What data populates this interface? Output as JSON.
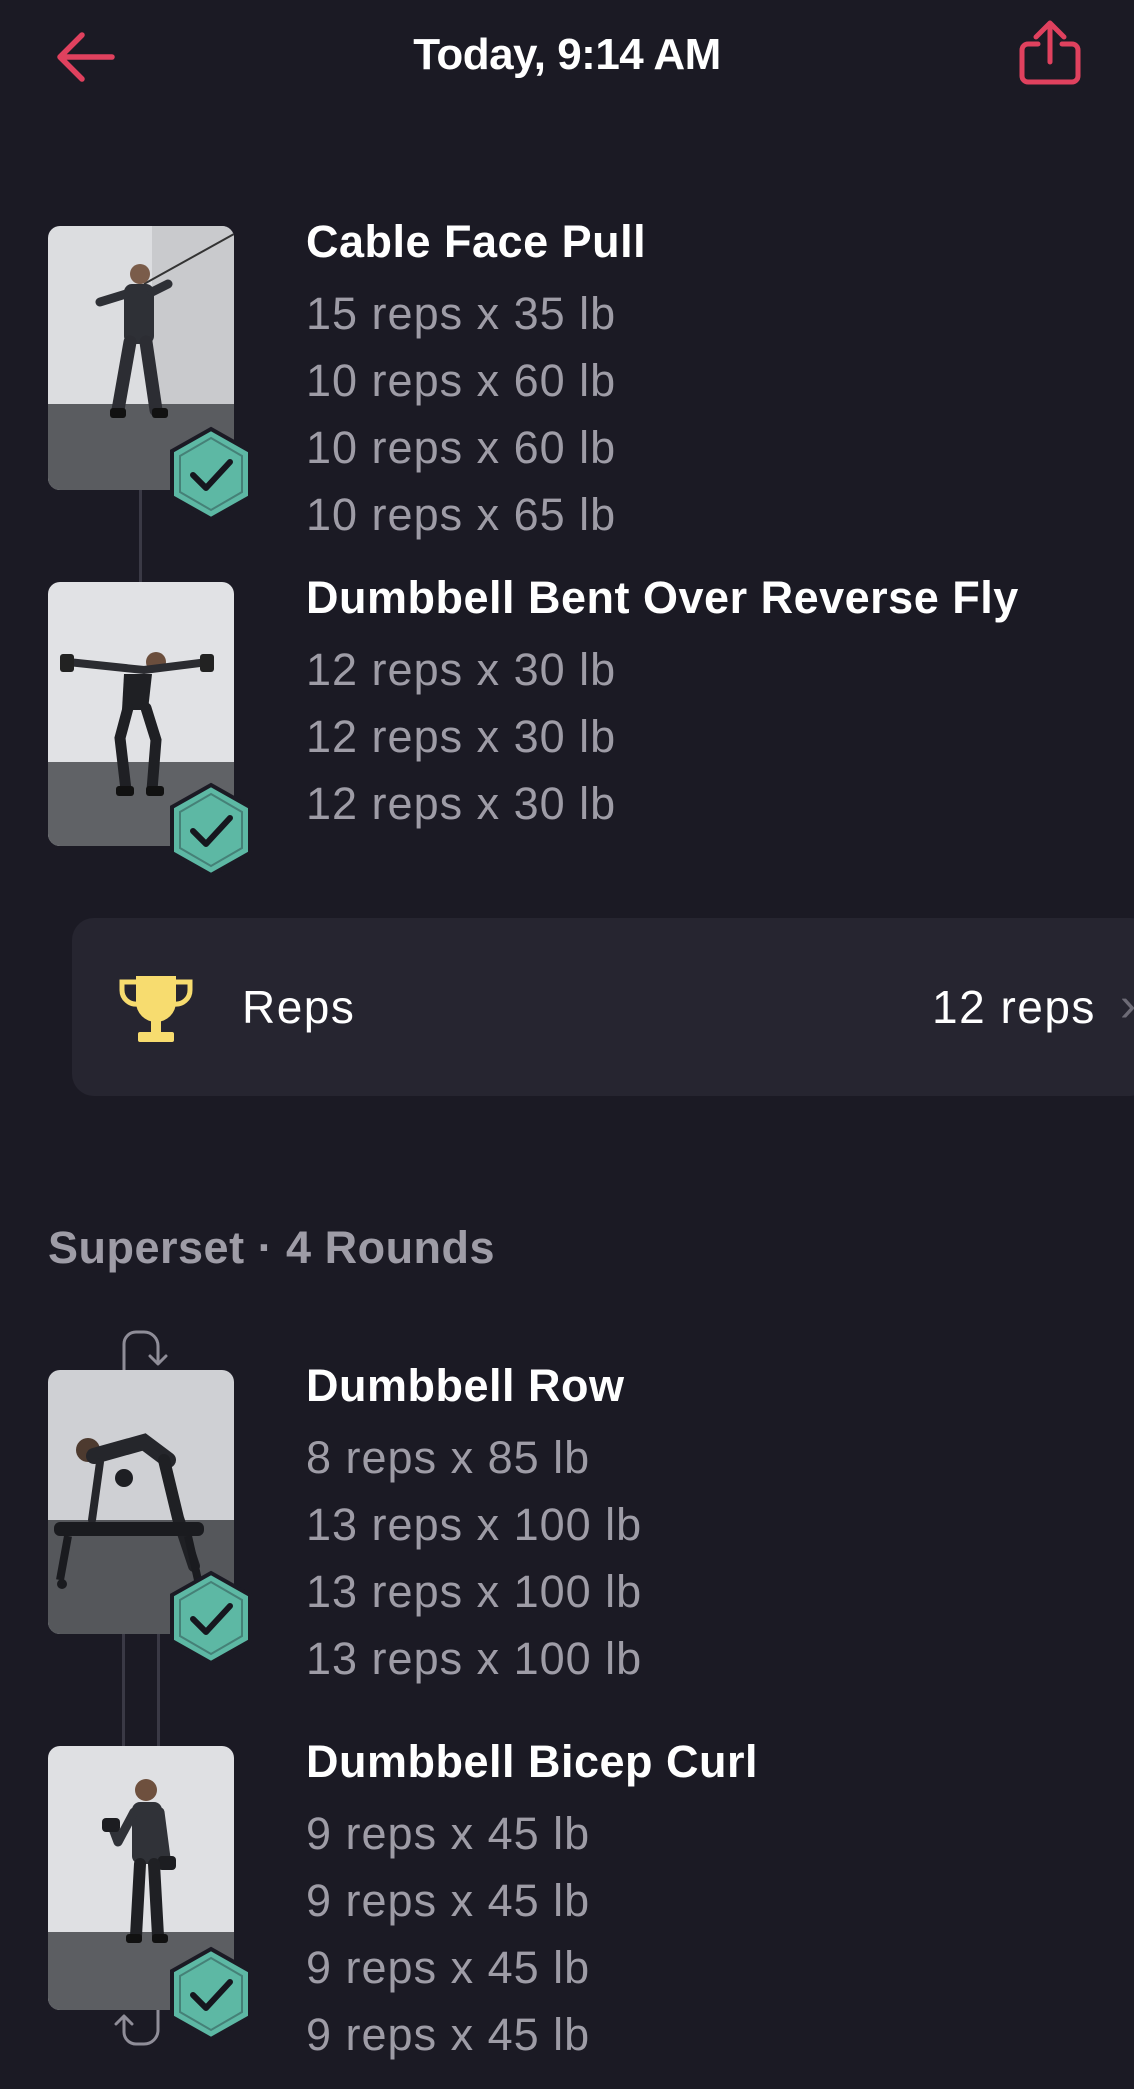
{
  "header": {
    "title": "Today, 9:14 AM",
    "back_icon": "arrow-left-icon",
    "share_icon": "share-icon",
    "accent_color": "#e0415e"
  },
  "exercises": [
    {
      "name": "Cable Face Pull",
      "completed": true,
      "sets": [
        "15 reps x 35 lb",
        "10 reps x 60 lb",
        "10 reps x 60 lb",
        "10 reps x 65 lb"
      ]
    },
    {
      "name": "Dumbbell Bent Over Reverse Fly",
      "completed": true,
      "sets": [
        "12 reps x 30 lb",
        "12 reps x 30 lb",
        "12 reps x 30 lb"
      ]
    }
  ],
  "personal_record": {
    "icon": "trophy-icon",
    "label": "Reps",
    "value": "12 reps",
    "chevron": "›",
    "icon_color": "#f7dc6f"
  },
  "superset": {
    "label": "Superset · 4 Rounds",
    "exercises": [
      {
        "name": "Dumbbell Row",
        "completed": true,
        "sets": [
          "8 reps x 85 lb",
          "13 reps x 100 lb",
          "13 reps x 100 lb",
          "13 reps x 100 lb"
        ]
      },
      {
        "name": "Dumbbell Bicep Curl",
        "completed": true,
        "sets": [
          "9 reps x 45 lb",
          "9 reps x 45 lb",
          "9 reps x 45 lb",
          "9 reps x 45 lb"
        ]
      }
    ]
  },
  "colors": {
    "background": "#1b1a24",
    "card": "#262530",
    "secondary_text": "#9e9ca6",
    "check_badge": "#5db8a4"
  }
}
